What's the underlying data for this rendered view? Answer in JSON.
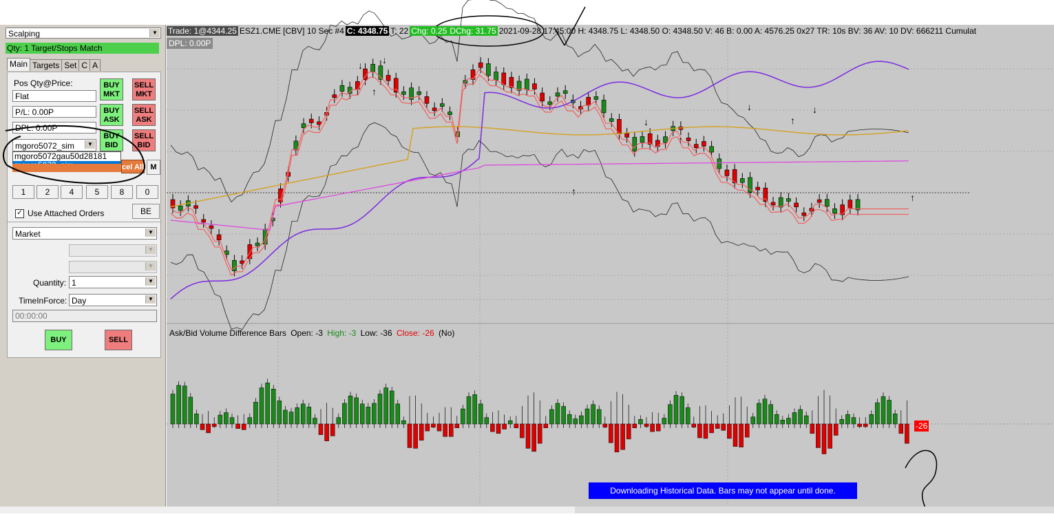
{
  "panel": {
    "strategy": "Scalping",
    "status_bar": "Qty: 1 Target/Stops Match",
    "tabs": [
      "Main",
      "Targets",
      "Set",
      "C",
      "A"
    ],
    "pos_label": "Pos Qty@Price:",
    "pos_value": "Flat",
    "pl_value": "P/L: 0.00P",
    "dpl_value": "DPL: 0.00P",
    "buy_mkt": "BUY MKT",
    "sell_mkt": "SELL MKT",
    "buy_ask": "BUY ASK",
    "sell_ask": "SELL ASK",
    "buy_bid": "BUY BID",
    "sell_bid": "SELL BID",
    "account_selected": "mgoro5072_sim",
    "account_options": [
      "mgoro5072gau50d28181",
      "mgoro5072_sim"
    ],
    "cancel_all": "cel All",
    "m_button": "M",
    "qty_buttons": [
      "1",
      "2",
      "4",
      "5",
      "8",
      "0"
    ],
    "attached_orders_label": "Use Attached Orders",
    "attached_orders_checked": true,
    "be_button": "BE",
    "order_type": "Market",
    "quantity_label": "Quantity:",
    "quantity_value": "1",
    "tif_label": "TimeInForce:",
    "tif_value": "Day",
    "time_value": "00:00:00",
    "buy_button": "BUY",
    "sell_button": "SELL"
  },
  "chart": {
    "trade": "Trade: 1@4344.25",
    "symbol": "ESZ1.CME [CBV]  10 Sec   #4",
    "close": "C: 4348.75",
    "t": "T: 22",
    "chg": "Chg: 0.25",
    "dchg": "DChg: 31.75",
    "rest": "2021-09-28 17:45:00 H: 4348.75 L: 4348.50 O: 4348.50 V: 46 B: 0.00 A: 4576.25 0x27 TR: 10s BV: 36 AV: 10 DV: 666211 Cumulat",
    "dpl": "DPL: 0.00P",
    "study_name": "Ask/Bid Volume Difference Bars",
    "study_open": "Open: -3",
    "study_high": "High: -3",
    "study_low": "Low: -36",
    "study_close": "Close: -26",
    "study_flag": "(No)",
    "diff_value": "-26",
    "download_msg": "Downloading Historical Data. Bars may not appear until done."
  },
  "colors": {
    "bull": "#1a8a1a",
    "bear": "#e00000",
    "purple": "#7a2ae0",
    "magenta": "#e040e0",
    "ema": "#f06060",
    "gold": "#d4a020",
    "bg": "#c8c8c8"
  },
  "icons": [
    "dropdown-arrow-icon",
    "checkbox-icon",
    "up-arrow-signal-icon",
    "down-arrow-signal-icon"
  ]
}
